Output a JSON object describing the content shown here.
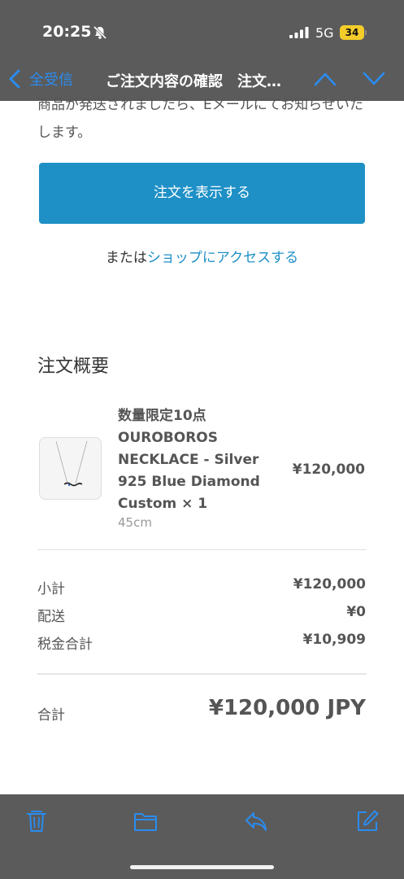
{
  "status_bar": {
    "time": "20:25",
    "network": "5G",
    "battery": "34"
  },
  "nav": {
    "back_label": "全受信",
    "title": "ご注文内容の確認　注文…"
  },
  "notice_text": "商品が発送されましたら、Eメールにてお知らせいたします。",
  "view_order_label": "注文を表示する",
  "or_text": "または",
  "shop_link_label": "ショップにアクセスする",
  "summary": {
    "title": "注文概要",
    "product": {
      "name": "数量限定10点 OUROBOROS NECKLACE - Silver 925 Blue Diamond Custom × 1",
      "variant": "45cm",
      "price": "¥120,000"
    },
    "rows": [
      {
        "label": "小計",
        "value": "¥120,000"
      },
      {
        "label": "配送",
        "value": "¥0"
      },
      {
        "label": "税金合計",
        "value": "¥10,909"
      }
    ],
    "total_label": "合計",
    "total_value": "¥120,000 JPY"
  },
  "colors": {
    "bar_bg": "#5b5b5b",
    "accent": "#1e90c6",
    "ios_blue": "#2a8cf0",
    "battery": "#f5cd2a"
  },
  "toolbar_icons": [
    "trash-icon",
    "folder-icon",
    "reply-icon",
    "compose-icon"
  ]
}
